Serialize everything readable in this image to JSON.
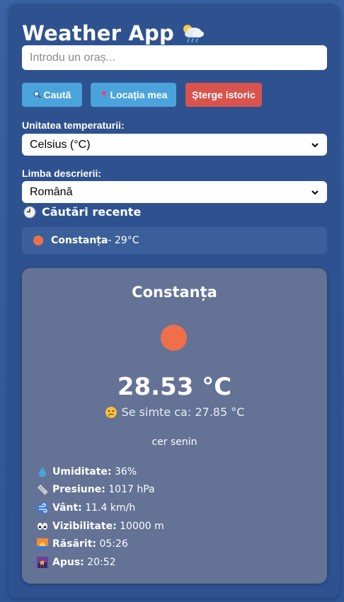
{
  "app": {
    "title": "Weather App",
    "title_icon": "cloud-rain-sun-icon"
  },
  "search": {
    "placeholder": "Introdu un oraș...",
    "value": ""
  },
  "buttons": {
    "search_label": "Caută",
    "location_label": "Locația mea",
    "clear_label": "Șterge istoric",
    "search_icon": "magnifier-icon",
    "location_icon": "pin-icon"
  },
  "settings": {
    "unit_label": "Unitatea temperaturii:",
    "unit_value": "Celsius (°C)",
    "lang_label": "Limba descrierii:",
    "lang_value": "Română"
  },
  "recent": {
    "header": "Căutări recente",
    "items": [
      {
        "city": "Constanța",
        "temp": " - 29°C"
      }
    ]
  },
  "weather": {
    "city": "Constanța",
    "temperature": "28.53 °C",
    "feels_like": "Se simte ca: 27.85 °C",
    "description": "cer senin",
    "details": [
      {
        "icon": "droplet-icon",
        "label": "Umiditate:",
        "value": " 36%"
      },
      {
        "icon": "ruler-icon",
        "label": "Presiune:",
        "value": " 1017 hPa"
      },
      {
        "icon": "wind-icon",
        "label": "Vânt:",
        "value": " 11.4 km/h"
      },
      {
        "icon": "eyes-icon",
        "label": "Vizibilitate:",
        "value": " 10000 m"
      },
      {
        "icon": "sunrise-icon",
        "label": "Răsărit:",
        "value": " 05:26"
      },
      {
        "icon": "sunset-icon",
        "label": "Apus:",
        "value": " 20:52"
      }
    ]
  },
  "colors": {
    "background": "#2e528f",
    "button_primary": "#4ba3dc",
    "button_danger": "#d9534f",
    "card": "#637295",
    "sun": "#ef6f4b"
  }
}
